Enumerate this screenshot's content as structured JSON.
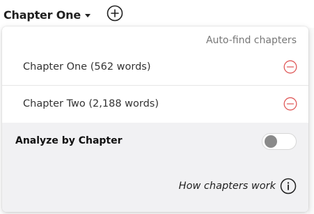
{
  "header": {
    "current_chapter": "Chapter One"
  },
  "panel": {
    "auto_find_label": "Auto-find chapters",
    "chapters": [
      {
        "label": "Chapter One  (562 words)"
      },
      {
        "label": "Chapter Two  (2,188 words)"
      }
    ],
    "analyze": {
      "label": "Analyze by Chapter",
      "enabled": false
    },
    "help_link": "How chapters work"
  },
  "colors": {
    "remove_icon": "#e05a5a",
    "analyze_bg": "#f1f1f3",
    "toggle_knob_off": "#8a8a8a"
  },
  "icons": {
    "add": "plus-circle-icon",
    "remove": "minus-circle-icon",
    "info": "info-circle-icon",
    "caret": "caret-down-icon"
  }
}
